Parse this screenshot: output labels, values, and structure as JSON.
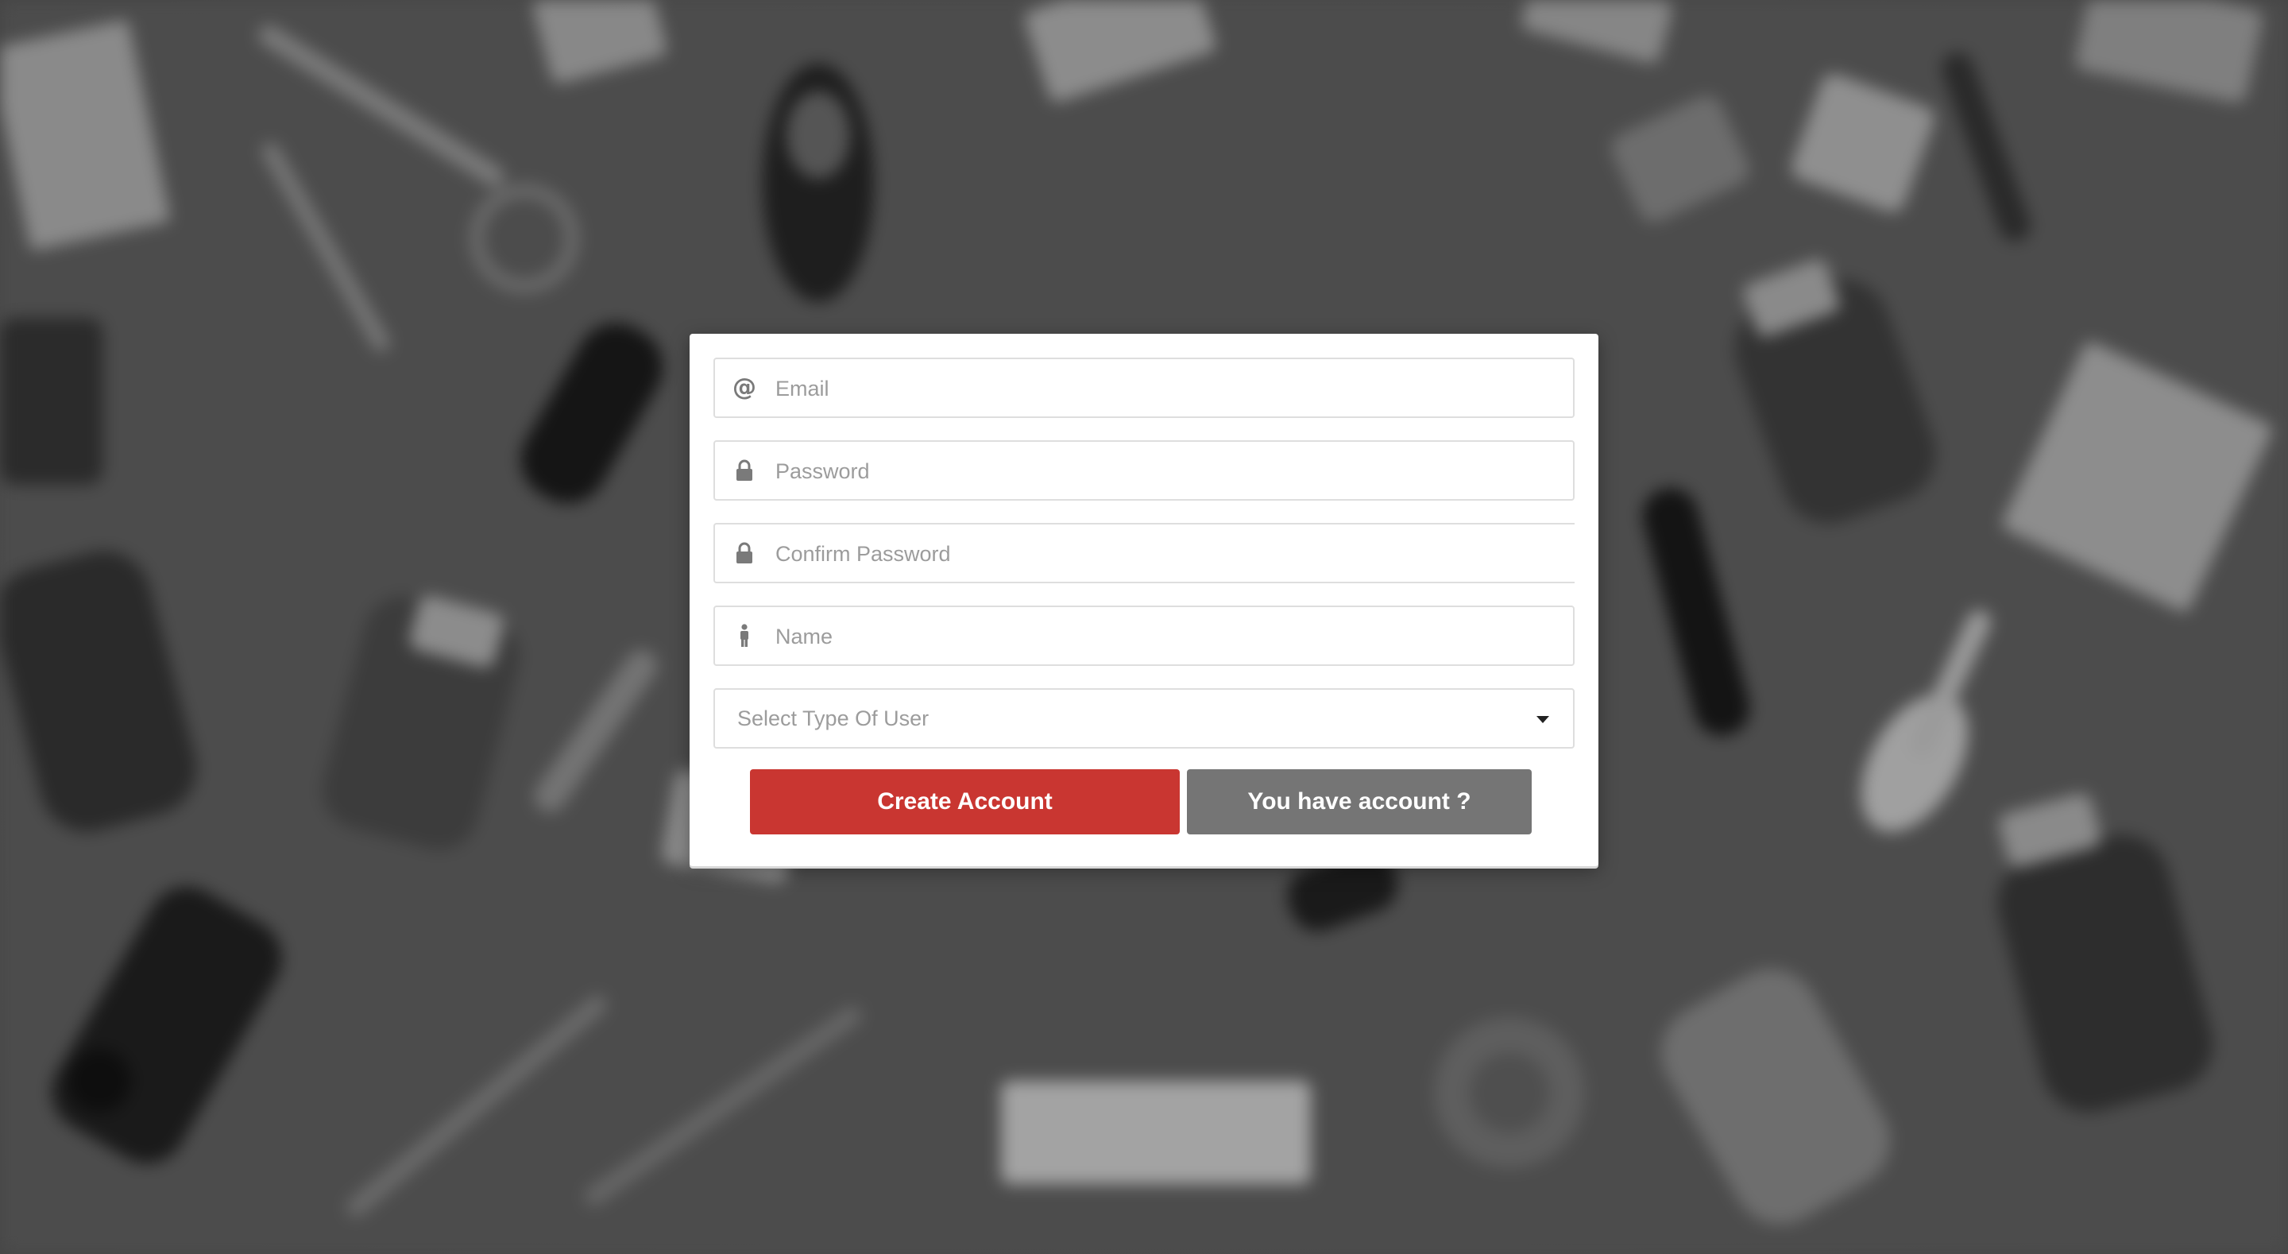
{
  "form": {
    "email": {
      "placeholder": "Email",
      "icon": "at-icon"
    },
    "password": {
      "placeholder": "Password",
      "icon": "lock-icon"
    },
    "confirm_password": {
      "placeholder": "Confirm Password",
      "icon": "lock-icon"
    },
    "name": {
      "placeholder": "Name",
      "icon": "person-icon"
    },
    "user_type": {
      "placeholder": "Select Type Of User",
      "icon": "caret-down-icon"
    }
  },
  "buttons": {
    "create_account": "Create Account",
    "have_account": "You have account ?"
  },
  "colors": {
    "primary": "#c93631",
    "secondary": "#757575",
    "card": "#ffffff",
    "border": "#dedede",
    "placeholder": "#9c9c9c"
  }
}
